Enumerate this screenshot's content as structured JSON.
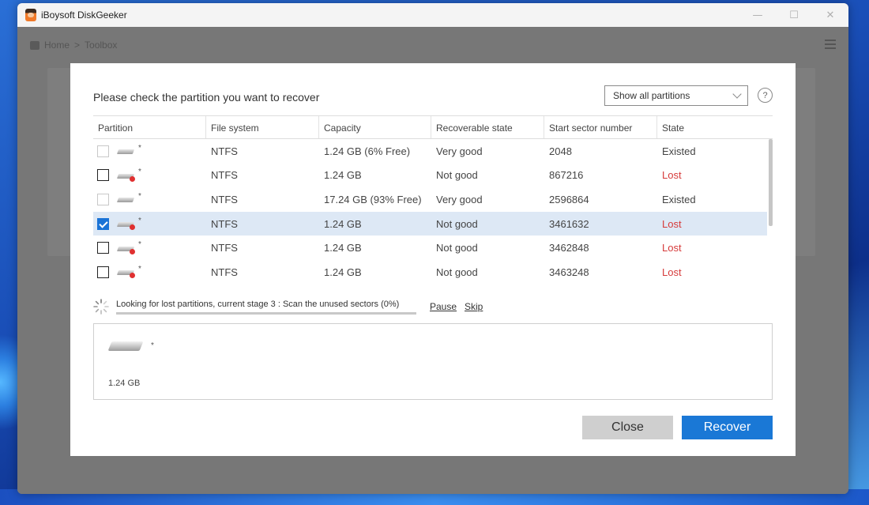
{
  "window": {
    "title": "iBoysoft DiskGeeker",
    "controls": {
      "minimize": "—",
      "maximize": "☐",
      "close": "✕"
    }
  },
  "background": {
    "breadcrumb": [
      "Home",
      ">",
      "Toolbox"
    ]
  },
  "dialog": {
    "prompt": "Please check the partition you want to recover",
    "filter": {
      "selected": "Show all partitions"
    },
    "help": "?",
    "columns": [
      "Partition",
      "File system",
      "Capacity",
      "Recoverable state",
      "Start sector number",
      "State"
    ],
    "rows": [
      {
        "checkbox": "disabled",
        "lost_icon": false,
        "name": "*",
        "filesystem": "NTFS",
        "capacity": "1.24 GB (6% Free)",
        "recoverable": "Very good",
        "start_sector": "2048",
        "state": "Existed"
      },
      {
        "checkbox": "unchecked",
        "lost_icon": true,
        "name": "*",
        "filesystem": "NTFS",
        "capacity": "1.24 GB",
        "recoverable": "Not good",
        "start_sector": "867216",
        "state": "Lost"
      },
      {
        "checkbox": "disabled",
        "lost_icon": false,
        "name": "*",
        "filesystem": "NTFS",
        "capacity": "17.24 GB (93% Free)",
        "recoverable": "Very good",
        "start_sector": "2596864",
        "state": "Existed"
      },
      {
        "checkbox": "checked",
        "lost_icon": true,
        "name": "*",
        "filesystem": "NTFS",
        "capacity": "1.24 GB",
        "recoverable": "Not good",
        "start_sector": "3461632",
        "state": "Lost"
      },
      {
        "checkbox": "unchecked",
        "lost_icon": true,
        "name": "*",
        "filesystem": "NTFS",
        "capacity": "1.24 GB",
        "recoverable": "Not good",
        "start_sector": "3462848",
        "state": "Lost"
      },
      {
        "checkbox": "unchecked",
        "lost_icon": true,
        "name": "*",
        "filesystem": "NTFS",
        "capacity": "1.24 GB",
        "recoverable": "Not good",
        "start_sector": "3463248",
        "state": "Lost"
      }
    ],
    "progress": {
      "text": "Looking for lost partitions, current stage 3 : Scan the unused sectors",
      "percent_label": "(0%)",
      "fraction": 0.0,
      "pause_label": "Pause",
      "skip_label": "Skip"
    },
    "detail": {
      "name": "*",
      "size": "1.24 GB"
    },
    "buttons": {
      "close": "Close",
      "recover": "Recover"
    }
  },
  "colors": {
    "accent": "#1a78d6",
    "lost": "#d63a3a",
    "selected_row": "#dde8f5"
  }
}
